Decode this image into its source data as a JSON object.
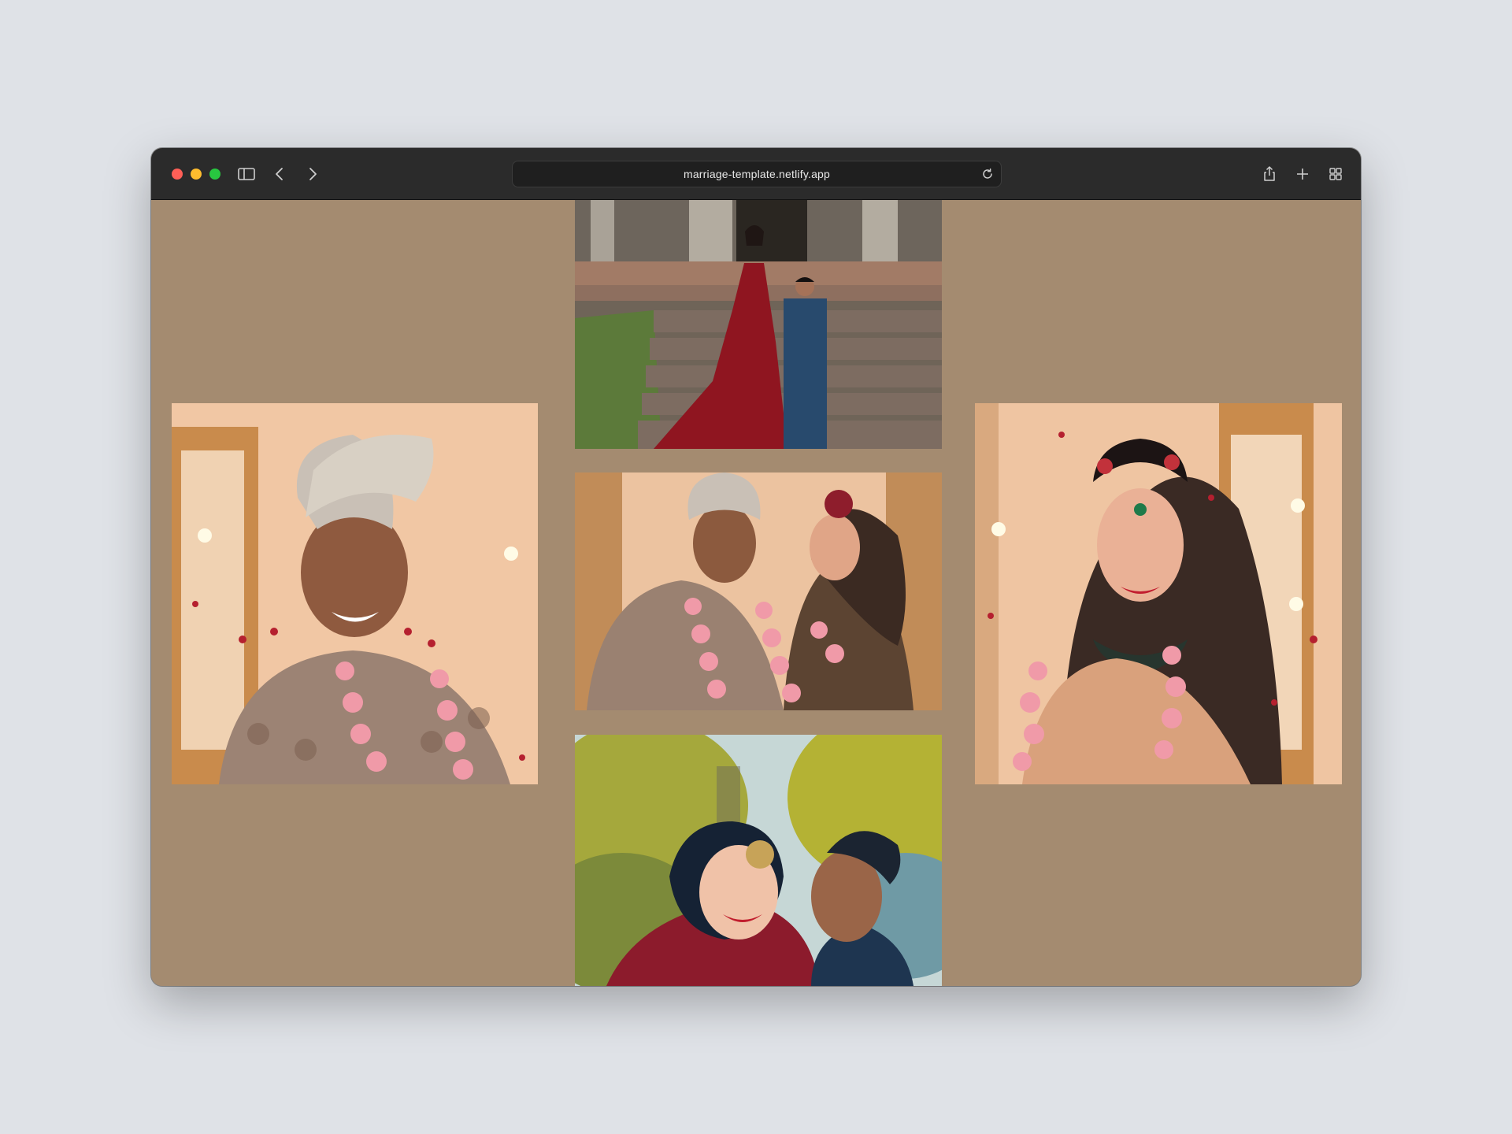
{
  "browser": {
    "url": "marriage-template.netlify.app",
    "icons": [
      "sidebar-icon",
      "back-chevron-icon",
      "forward-chevron-icon",
      "reload-icon",
      "share-icon",
      "new-tab-plus-icon",
      "tab-overview-grid-icon"
    ]
  },
  "page": {
    "background_color": "#a48b70",
    "gallery": [
      {
        "id": "couple-steps",
        "subject": "bride in red lehenga and groom in blue sherwani on stone steps"
      },
      {
        "id": "groom-portrait",
        "subject": "groom in turban with rose garland"
      },
      {
        "id": "couple-smiling",
        "subject": "groom and bride smiling at each other"
      },
      {
        "id": "bride-portrait",
        "subject": "bride with maang tikka and rose garland"
      },
      {
        "id": "couple-laughing",
        "subject": "couple laughing outdoors"
      }
    ]
  }
}
